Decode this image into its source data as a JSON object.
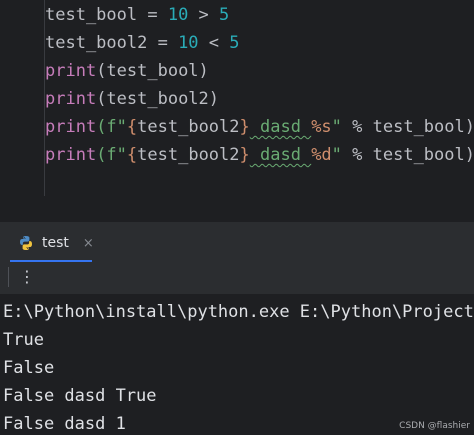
{
  "editor": {
    "lines": [
      {
        "a": "test_bool = ",
        "b": "10",
        "c": " > ",
        "d": "5"
      },
      {
        "a": "test_bool2 = ",
        "b": "10",
        "c": " < ",
        "d": "5"
      },
      {
        "fn": "print",
        "rest": "(test_bool)"
      },
      {
        "fn": "print",
        "rest": "(test_bool2)"
      },
      {
        "fn": "print",
        "open": "(f\"",
        "br1": "{",
        "var": "test_bool2",
        "br2": "}",
        "str": " dasd ",
        "fmt": "%s",
        "close": "\"",
        "tail": " % test_bool)"
      },
      {
        "fn": "print",
        "open": "(f\"",
        "br1": "{",
        "var": "test_bool2",
        "br2": "}",
        "str": " dasd ",
        "fmt": "%d",
        "close": "\"",
        "tail": " % test_bool)"
      }
    ]
  },
  "run_panel": {
    "tab_label": "test",
    "tab_close": "×",
    "menu_icon": "⋮",
    "output": [
      "E:\\Python\\install\\python.exe E:\\Python\\Project\\",
      "True",
      "False",
      "False dasd True",
      "False dasd 1"
    ]
  },
  "watermark": "CSDN @flashier",
  "colors": {
    "editor_bg": "#1e1f22",
    "panel_bg": "#2b2d30",
    "number": "#2aacb8",
    "function": "#56a8f5",
    "string": "#6aab73",
    "brace": "#cf8e6d",
    "accent": "#3574f0"
  },
  "icons": {
    "tab": "python-icon",
    "close": "close-icon",
    "menu": "kebab-menu-icon"
  }
}
